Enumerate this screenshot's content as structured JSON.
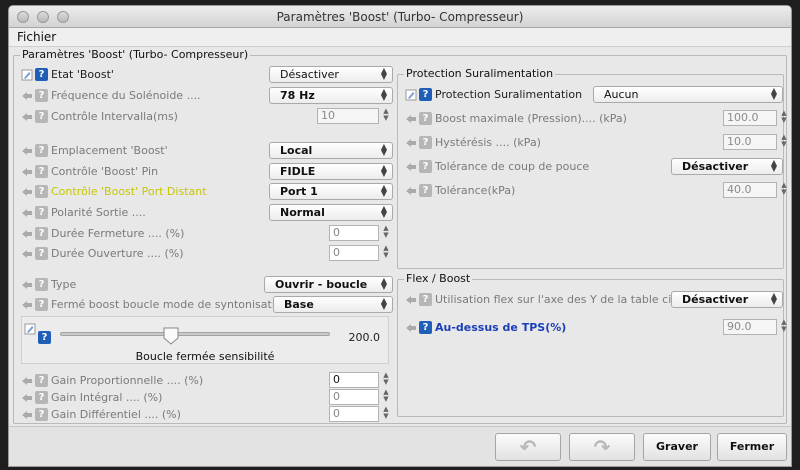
{
  "window": {
    "title": "Paramètres 'Boost' (Turbo- Compresseur)",
    "menu_file": "Fichier"
  },
  "main_group_title": "Paramètres 'Boost' (Turbo- Compresseur)",
  "left": {
    "etat": {
      "label": "Etat 'Boost'",
      "value": "Désactiver"
    },
    "freq": {
      "label": "Fréquence du Solénoide ....",
      "value": "78 Hz"
    },
    "ctrl_interval": {
      "label": "Contrôle Intervalla(ms)",
      "value": "10"
    },
    "emplacement": {
      "label": "Emplacement 'Boost'",
      "value": "Local"
    },
    "ctrl_pin": {
      "label": "Contrôle 'Boost' Pin",
      "value": "FIDLE"
    },
    "ctrl_port": {
      "label": "Contrôle 'Boost' Port Distant",
      "value": "Port 1"
    },
    "polarite": {
      "label": "Polarité Sortie ....",
      "value": "Normal"
    },
    "duree_fermeture": {
      "label": "Durée Fermeture .... (%)",
      "value": "0"
    },
    "duree_ouverture": {
      "label": "Durée Ouverture .... (%)",
      "value": "0"
    },
    "type": {
      "label": "Type",
      "value": "Ouvrir - boucle"
    },
    "ferme_mode": {
      "label": "Fermé boost boucle mode de syntonisation",
      "value": "Base"
    },
    "slider": {
      "value_text": "200.0",
      "caption": "Boucle fermée sensibilité",
      "fraction": 0.41
    },
    "gain_prop": {
      "label": "Gain Proportionnelle .... (%)",
      "value": "0"
    },
    "gain_int": {
      "label": "Gain Intégral .... (%)",
      "value": "0"
    },
    "gain_diff": {
      "label": "Gain Différentiel .... (%)",
      "value": "0"
    }
  },
  "protection": {
    "title": "Protection Suralimentation",
    "prot": {
      "label": "Protection Suralimentation",
      "value": "Aucun"
    },
    "boost_max": {
      "label": "Boost maximale (Pression).... (kPa)",
      "value": "100.0"
    },
    "hysteresis": {
      "label": "Hystérésis .... (kPa)",
      "value": "10.0"
    },
    "tolerance_coup": {
      "label": "Tolérance de coup de pouce",
      "value": "Désactiver"
    },
    "tolerance": {
      "label": "Tolérance(kPa)",
      "value": "40.0"
    }
  },
  "flex": {
    "title": "Flex / Boost",
    "utilisation": {
      "label": "Utilisation flex sur l'axe des Y de la table cible",
      "value": "Désactiver"
    },
    "tps": {
      "label": "Au-dessus de TPS(%)",
      "value": "90.0"
    }
  },
  "buttons": {
    "undo_icon": "undo-arrow-icon",
    "redo_icon": "redo-arrow-icon",
    "save": "Graver",
    "close": "Fermer"
  },
  "colors": {
    "help_active": "#1f5fb8",
    "highlight_label": "#c8c800",
    "link_label": "#1a3fb8"
  }
}
